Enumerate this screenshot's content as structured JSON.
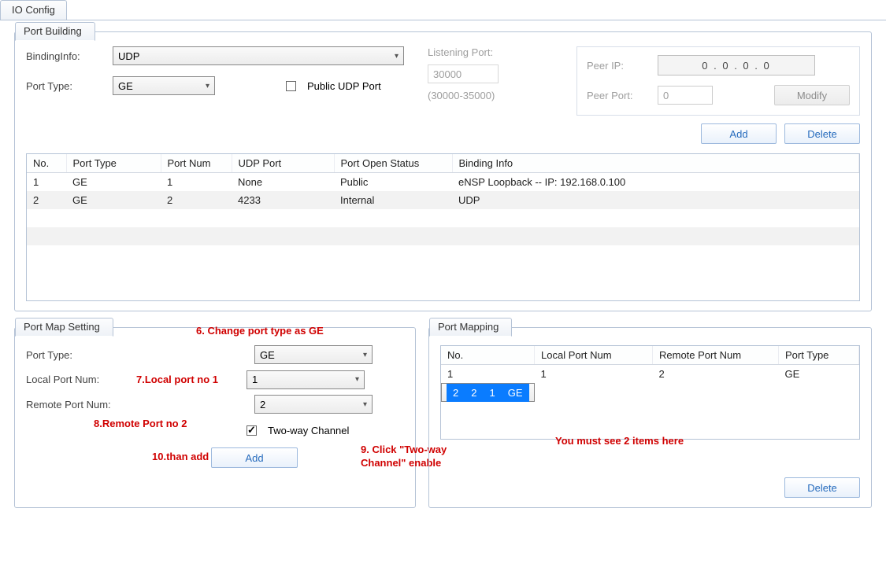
{
  "tab_main": "IO Config",
  "port_building": {
    "legend": "Port Building",
    "binding_info_label": "BindingInfo:",
    "binding_info_value": "UDP",
    "port_type_label": "Port Type:",
    "port_type_value": "GE",
    "public_udp_label": "Public UDP Port",
    "listening_port_label": "Listening Port:",
    "listening_port_value": "30000",
    "listening_port_range": "(30000-35000)",
    "peer_ip_label": "Peer IP:",
    "peer_ip_value": "0   .   0   .   0   .   0",
    "peer_port_label": "Peer Port:",
    "peer_port_value": "0",
    "modify_btn": "Modify",
    "add_btn": "Add",
    "delete_btn": "Delete",
    "grid": {
      "headers": [
        "No.",
        "Port Type",
        "Port Num",
        "UDP Port",
        "Port Open Status",
        "Binding Info"
      ],
      "rows": [
        {
          "no": "1",
          "port_type": "GE",
          "port_num": "1",
          "udp_port": "None",
          "status": "Public",
          "binding": "eNSP Loopback -- IP: 192.168.0.100"
        },
        {
          "no": "2",
          "port_type": "GE",
          "port_num": "2",
          "udp_port": "4233",
          "status": "Internal",
          "binding": "UDP"
        }
      ]
    }
  },
  "port_map_setting": {
    "legend": "Port Map Setting",
    "port_type_label": "Port Type:",
    "port_type_value": "GE",
    "local_port_label": "Local Port Num:",
    "local_port_value": "1",
    "remote_port_label": "Remote Port Num:",
    "remote_port_value": "2",
    "two_way_label": "Two-way Channel",
    "add_btn": "Add"
  },
  "port_mapping": {
    "legend": "Port Mapping",
    "headers": [
      "No.",
      "Local Port Num",
      "Remote Port Num",
      "Port Type"
    ],
    "rows": [
      {
        "no": "1",
        "local": "1",
        "remote": "2",
        "type": "GE",
        "selected": false
      },
      {
        "no": "2",
        "local": "2",
        "remote": "1",
        "type": "GE",
        "selected": true
      }
    ],
    "delete_btn": "Delete"
  },
  "annotations": {
    "a6": "6. Change port type as GE",
    "a7": "7.Local port no 1",
    "a8": "8.Remote Port no 2",
    "a9": "9. Click \"Two-way Channel\" enable",
    "a10": "10.than add",
    "must": "You must see 2 items here"
  }
}
